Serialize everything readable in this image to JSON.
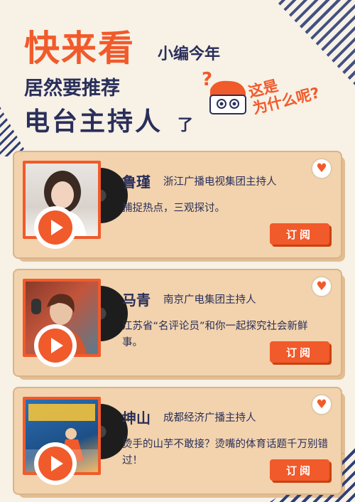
{
  "header": {
    "big": "快来看",
    "small": "小编今年",
    "line2": "居然要推荐",
    "line3": "电台主持人",
    "le": "了",
    "why_line1": "这是",
    "why_line2": "为什么呢?"
  },
  "cards": [
    {
      "name": "鲁瑾",
      "org": "浙江广播电视集团主持人",
      "desc": "捕捉热点，三观探讨。",
      "button": "订阅"
    },
    {
      "name": "马青",
      "org": "南京广电集团主持人",
      "desc": "江苏省“名评论员”和你一起探究社会新鲜事。",
      "button": "订阅"
    },
    {
      "name": "坤山",
      "org": "成都经济广播主持人",
      "desc": "烫手的山芋不敢接？烫嘴的体育话题千万别错过！",
      "button": "订阅"
    }
  ],
  "colors": {
    "accent": "#f15a2b",
    "navy": "#2a2f5a",
    "card": "#f2d3ad"
  },
  "icons": {
    "heart": "heart-icon",
    "play": "play-icon"
  }
}
